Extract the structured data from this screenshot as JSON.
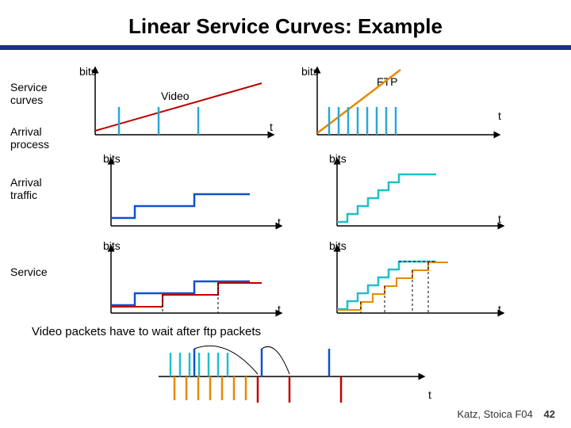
{
  "title": "Linear Service Curves: Example",
  "rows": {
    "service_curves": {
      "label": "Service\ncurves",
      "left_y": "bits",
      "left_curve_label": "Video",
      "left_x": "t",
      "right_y": "bits",
      "right_curve_label": "FTP",
      "right_x": "t"
    },
    "arrival_traffic": {
      "label_left_axis": "Arrival\nprocess",
      "row_label": "Arrival\ntraffic",
      "left_y": "bits",
      "left_x": "t",
      "right_y": "bits",
      "right_x": "t"
    },
    "service": {
      "row_label": "Service",
      "left_y": "bits",
      "left_x": "t",
      "right_y": "bits",
      "right_x": "t"
    }
  },
  "caption": "Video packets have to wait after ftp packets",
  "bottom_axis_x": "t",
  "footer": {
    "credit": "Katz, Stoica F04",
    "page": "42"
  },
  "chart_data": {
    "type": "diagram",
    "note": "Qualitative sketch — six mini time-vs-bits plots in a 3×2 grid. Left column = Video stream, right column = FTP stream. Rows: service curves (linear), arrival traffic (step), service (step with delay). Bottom center: combined packet arrival/service timeline showing video packets delayed behind FTP.",
    "grid": [
      {
        "row": 0,
        "col": 0,
        "series": "Video",
        "kind": "linear-service-curve-shallow",
        "impulses": 3
      },
      {
        "row": 0,
        "col": 1,
        "series": "FTP",
        "kind": "linear-service-curve-steep",
        "impulses": 8
      },
      {
        "row": 1,
        "col": 0,
        "series": "Video",
        "kind": "arrival-step",
        "steps": 3
      },
      {
        "row": 1,
        "col": 1,
        "series": "FTP",
        "kind": "arrival-step",
        "steps": 7
      },
      {
        "row": 2,
        "col": 0,
        "series": "Video",
        "kind": "service-step-with-wait",
        "steps": 3
      },
      {
        "row": 2,
        "col": 1,
        "series": "FTP",
        "kind": "service-step-with-wait",
        "steps": 6
      }
    ]
  }
}
